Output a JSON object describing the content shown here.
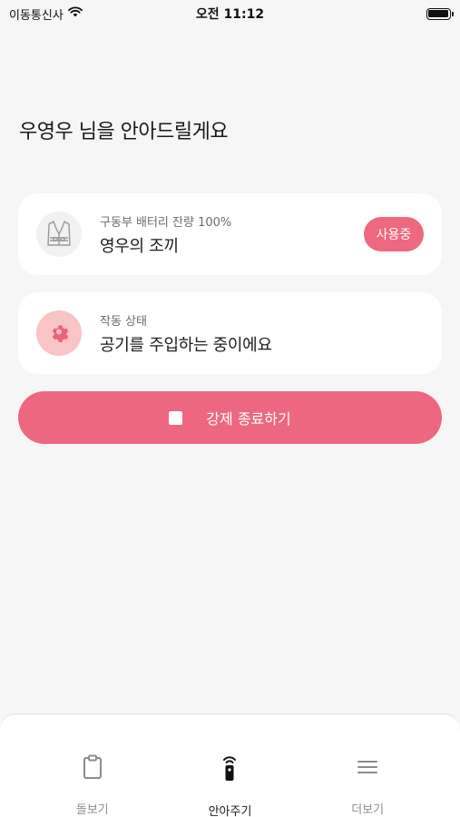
{
  "status_bar": {
    "carrier": "이동통신사",
    "time": "오전 11:12"
  },
  "greeting": "우영우 님을 안아드릴게요",
  "device_card": {
    "battery_label": "구동부 배터리 잔량 100%",
    "device_name": "영우의 조끼",
    "badge": "사용중",
    "icon": "vest-icon"
  },
  "status_card": {
    "label": "작동 상태",
    "value": "공기를 주입하는 중이에요",
    "icon": "gear-icon"
  },
  "stop_button": {
    "label": "강제 종료하기",
    "icon": "stop-icon"
  },
  "tab_bar": {
    "tabs": [
      {
        "label": "돌보기",
        "icon": "clipboard-icon",
        "active": false
      },
      {
        "label": "안아주기",
        "icon": "remote-icon",
        "active": true
      },
      {
        "label": "더보기",
        "icon": "menu-icon",
        "active": false
      }
    ]
  },
  "colors": {
    "accent": "#ee6780",
    "gear_bg": "#f8c4c6",
    "background": "#f6f6f6"
  }
}
